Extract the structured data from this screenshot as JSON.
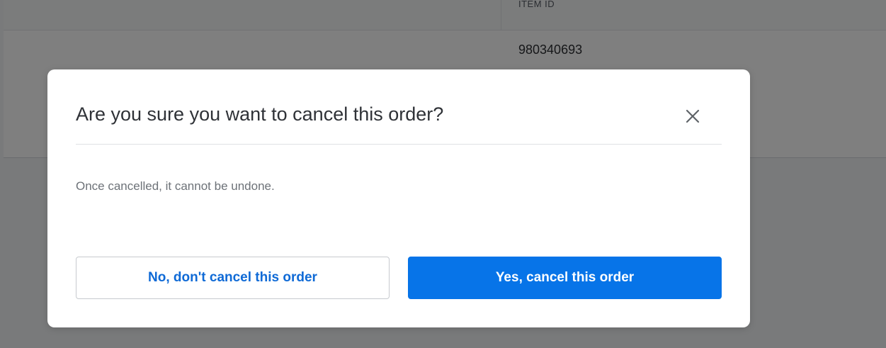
{
  "background_table": {
    "column_header": "ITEM ID",
    "item_id": "980340693"
  },
  "modal": {
    "title": "Are you sure you want to cancel this order?",
    "close_icon": "close-icon",
    "message": "Once cancelled, it cannot be undone.",
    "secondary_button_label": "No, don't cancel this order",
    "primary_button_label": "Yes, cancel this order"
  },
  "colors": {
    "primary": "#0774e8",
    "secondary_text": "#0f6ad6",
    "overlay": "rgba(0,0,0,0.5)"
  }
}
